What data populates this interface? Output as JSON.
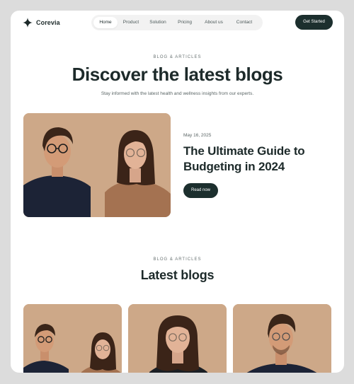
{
  "brand": {
    "name": "Corevia"
  },
  "nav": {
    "items": [
      {
        "label": "Home",
        "active": true
      },
      {
        "label": "Product",
        "active": false
      },
      {
        "label": "Solution",
        "active": false
      },
      {
        "label": "Pricing",
        "active": false
      },
      {
        "label": "About us",
        "active": false
      },
      {
        "label": "Contact",
        "active": false
      }
    ]
  },
  "header": {
    "cta_label": "Get Started"
  },
  "hero": {
    "eyebrow": "BLOG & ARTICLES",
    "title": "Discover the latest blogs",
    "subtitle": "Stay informed with the latest health and wellness insights from our experts."
  },
  "featured": {
    "date": "May 16, 2025",
    "title": "The Ultimate Guide to Budgeting in 2024",
    "button_label": "Read now"
  },
  "latest": {
    "eyebrow": "BLOG & ARTICLES",
    "title": "Latest blogs"
  },
  "colors": {
    "page_bg": "#dcdcdc",
    "card_bg": "#ffffff",
    "dark_green": "#1c2f2e",
    "photo_bg": "#cda888"
  },
  "icons": {
    "logo": "sparkle-star-icon"
  }
}
